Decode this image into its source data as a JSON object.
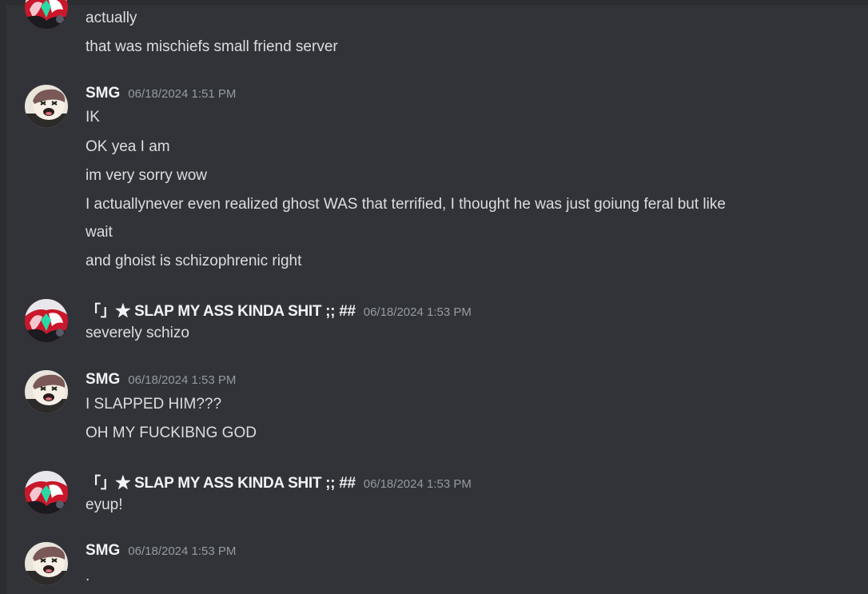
{
  "colors": {
    "background": "#313338",
    "username": "#f2f3f5",
    "message_text": "#dbdee1",
    "timestamp": "#949ba4"
  },
  "groups": [
    {
      "author": "",
      "timestamp": "",
      "avatar_icon": "anime-avatar-icon",
      "messages": [
        "actually",
        "that was mischiefs small friend server"
      ]
    },
    {
      "author": "SMG",
      "timestamp": "06/18/2024 1:51 PM",
      "avatar_icon": "cartoon-face-avatar-icon",
      "messages": [
        "IK",
        "OK yea I am",
        "im very sorry wow",
        "I actuallynever even realized ghost WAS that terrified, I thought he was just goiung feral but like",
        "wait",
        "and ghoist is schizophrenic right"
      ]
    },
    {
      "author": "「」★ SLAP MY ASS KINDA SHIT ;; ##",
      "timestamp": "06/18/2024 1:53 PM",
      "avatar_icon": "anime-avatar-icon",
      "messages": [
        "severely schizo"
      ]
    },
    {
      "author": "SMG",
      "timestamp": "06/18/2024 1:53 PM",
      "avatar_icon": "cartoon-face-avatar-icon",
      "messages": [
        "I SLAPPED HIM???",
        "OH MY FUCKIBNG GOD"
      ]
    },
    {
      "author": "「」★ SLAP MY ASS KINDA SHIT ;; ##",
      "timestamp": "06/18/2024 1:53 PM",
      "avatar_icon": "anime-avatar-icon",
      "messages": [
        "eyup!"
      ]
    },
    {
      "author": "SMG",
      "timestamp": "06/18/2024 1:53 PM",
      "avatar_icon": "cartoon-face-avatar-icon",
      "messages": [
        "."
      ]
    }
  ]
}
